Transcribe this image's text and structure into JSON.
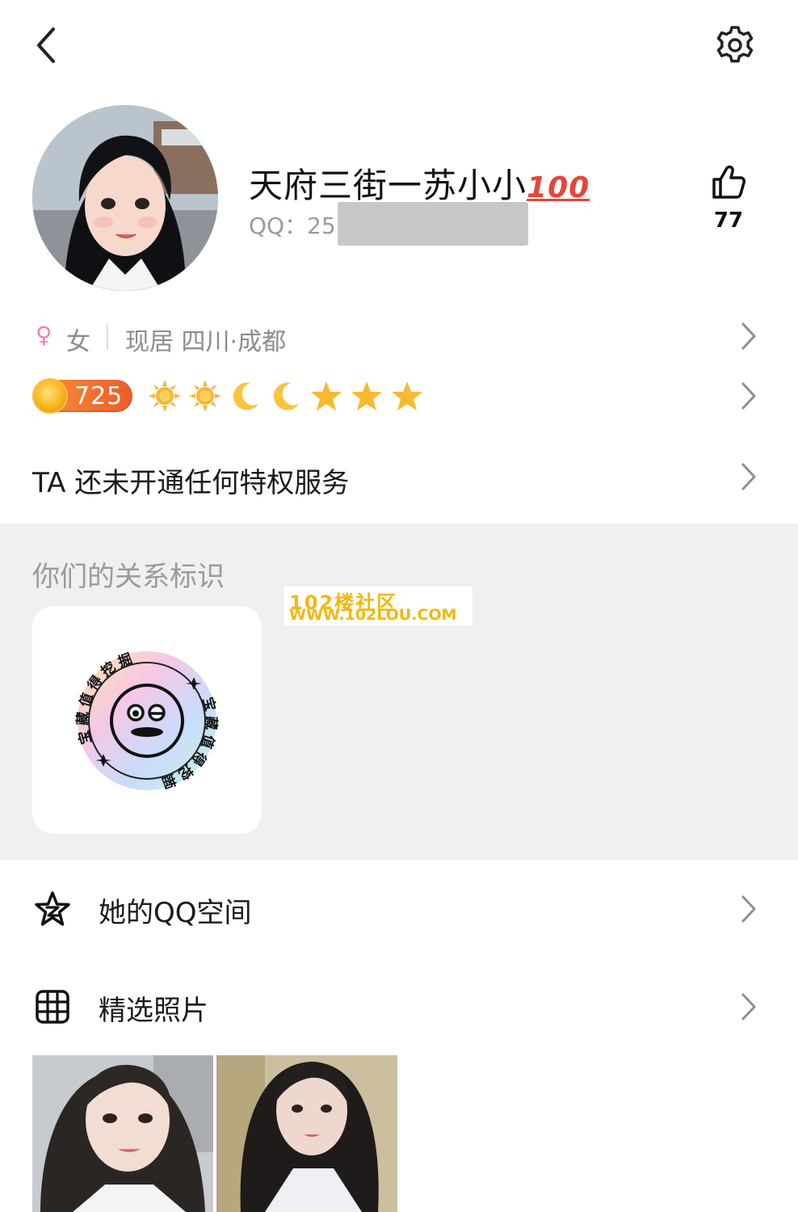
{
  "header": {
    "back_icon": "chevron-left-icon",
    "settings_icon": "gear-icon"
  },
  "profile": {
    "nickname": "天府三街一苏小小",
    "nickname_emoji": "100",
    "qq_label": "QQ：",
    "qq_visible_prefix": "25",
    "like_count": "77"
  },
  "info": {
    "gender_symbol": "♀",
    "gender": "女",
    "location": "现居 四川·成都"
  },
  "level": {
    "value": "725",
    "icons": [
      "sun",
      "sun",
      "moon",
      "moon",
      "star",
      "star",
      "star"
    ]
  },
  "vip": {
    "text": "TA 还未开通任何特权服务"
  },
  "relationship": {
    "title": "你们的关系标识",
    "badge_text": "宝藏值得挖掘"
  },
  "watermark": {
    "line1": "102楼社区",
    "line2": "WWW.102LOU.COM"
  },
  "menu": {
    "qzone": "她的QQ空间",
    "photos": "精选照片"
  },
  "colors": {
    "gender_pink": "#ef7fb2",
    "level_orange": "#ee5a2a",
    "section_bg": "#f0f0f2",
    "watermark_yellow": "#f2b80f"
  }
}
